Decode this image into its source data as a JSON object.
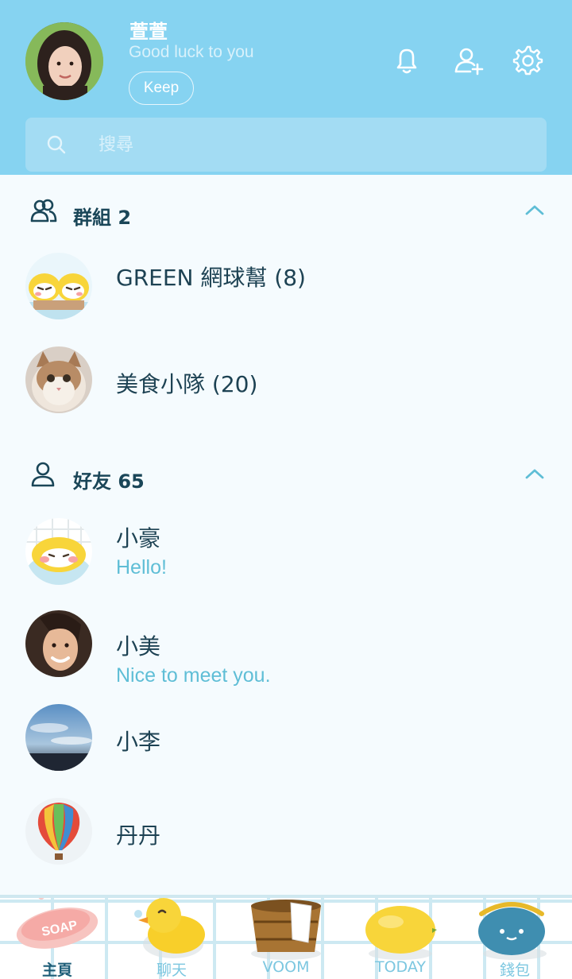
{
  "profile": {
    "name": "萱萱",
    "status": "Good luck to you",
    "keep_label": "Keep"
  },
  "search": {
    "placeholder": "搜尋"
  },
  "groups": {
    "label": "群組 2",
    "items": [
      {
        "name": "GREEN 網球幫 (8)"
      },
      {
        "name": "美食小隊 (20)"
      }
    ]
  },
  "friends": {
    "label": "好友 65",
    "items": [
      {
        "name": "小豪",
        "message": "Hello!"
      },
      {
        "name": "小美",
        "message": "Nice to meet you."
      },
      {
        "name": "小李",
        "message": ""
      },
      {
        "name": "丹丹",
        "message": ""
      }
    ]
  },
  "nav": {
    "items": [
      {
        "label": "主頁",
        "icon": "soap-icon"
      },
      {
        "label": "聊天",
        "icon": "duck-icon"
      },
      {
        "label": "VOOM",
        "icon": "bucket-icon"
      },
      {
        "label": "TODAY",
        "icon": "lemon-icon"
      },
      {
        "label": "錢包",
        "icon": "purse-icon"
      }
    ]
  },
  "colors": {
    "header_bg": "#86d3f1",
    "body_bg": "#f5fbfe",
    "accent": "#5fbed6",
    "text_dark": "#1d4253"
  }
}
